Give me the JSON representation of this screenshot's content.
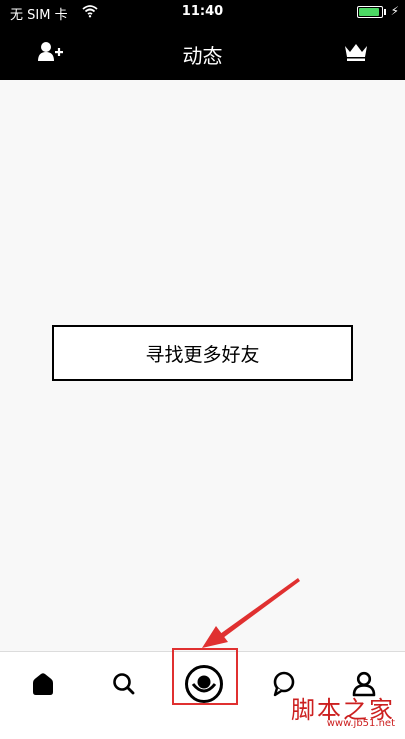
{
  "status_bar": {
    "carrier": "无 SIM 卡",
    "time": "11:40",
    "battery_level": 0.9,
    "battery_color": "#4cd964"
  },
  "nav_bar": {
    "title": "动态",
    "left_icon": "add-friend-icon",
    "right_icon": "crown-icon"
  },
  "main": {
    "find_friends_label": "寻找更多好友"
  },
  "tab_bar": {
    "tabs": [
      {
        "icon": "home-icon"
      },
      {
        "icon": "search-icon"
      },
      {
        "icon": "camera-icon"
      },
      {
        "icon": "chat-bubble-icon"
      },
      {
        "icon": "profile-icon"
      }
    ]
  },
  "annotation": {
    "highlight_color": "#e03030"
  },
  "watermark": {
    "text": "脚本之家",
    "url": "www.jb51.net"
  }
}
